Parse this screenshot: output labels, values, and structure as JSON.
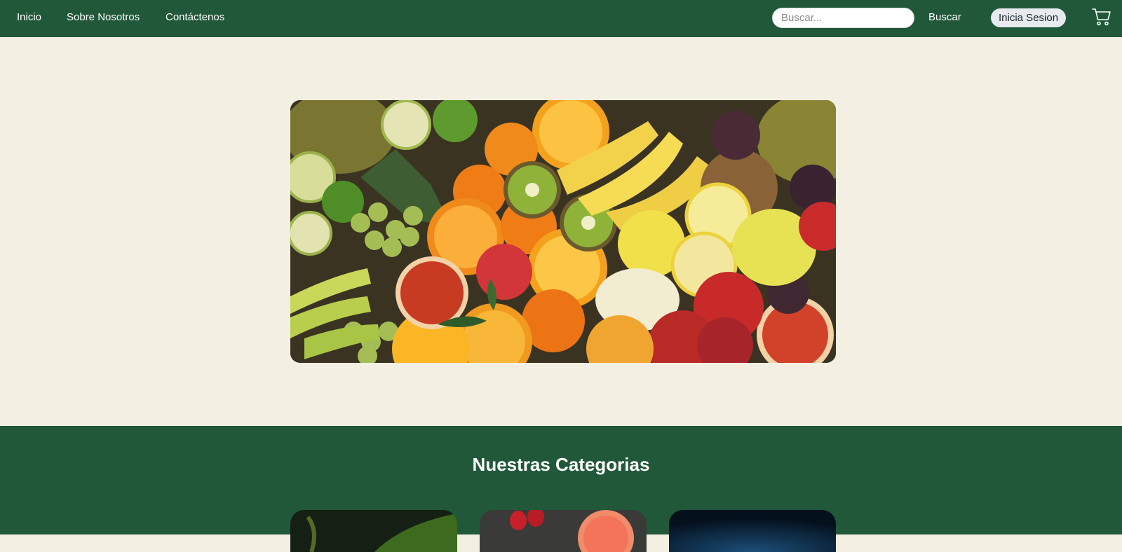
{
  "nav": {
    "links": [
      "Inicio",
      "Sobre Nosotros",
      "Contáctenos"
    ],
    "search_placeholder": "Buscar...",
    "search_button": "Buscar",
    "login_button": "Inicia Sesion",
    "cart_icon": "cart-icon"
  },
  "hero": {
    "image_icon": "fruit-photo"
  },
  "categories": {
    "title": "Nuestras Categorias",
    "cards": [
      "category-card-greens",
      "category-card-fruits",
      "category-card-dark"
    ]
  },
  "colors": {
    "primary_green": "#21583a",
    "background": "#f3efe3",
    "login_bg": "#e7ebee"
  }
}
